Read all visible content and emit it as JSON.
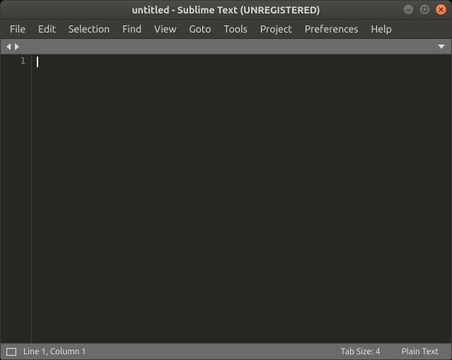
{
  "titlebar": {
    "title": "untitled - Sublime Text (UNREGISTERED)"
  },
  "menubar": {
    "items": [
      "File",
      "Edit",
      "Selection",
      "Find",
      "View",
      "Goto",
      "Tools",
      "Project",
      "Preferences",
      "Help"
    ]
  },
  "gutter": {
    "line1": "1"
  },
  "statusbar": {
    "position": "Line 1, Column 1",
    "tab_size": "Tab Size: 4",
    "syntax": "Plain Text"
  }
}
